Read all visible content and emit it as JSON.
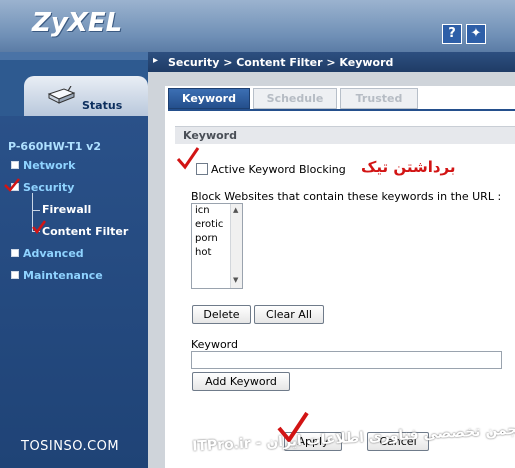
{
  "header": {
    "logo": "ZyXEL",
    "help_icon": "question-mark-icon",
    "wizard_icon": "wizard-icon"
  },
  "sidebar": {
    "status_tab": "Status",
    "status_icon": "router-icon",
    "model": "P-660HW-T1 v2",
    "items": [
      {
        "label": "Network"
      },
      {
        "label": "Security"
      },
      {
        "label": "Firewall"
      },
      {
        "label": "Content Filter"
      },
      {
        "label": "Advanced"
      },
      {
        "label": "Maintenance"
      }
    ]
  },
  "breadcrumb": "Security > Content Filter > Keyword",
  "tabs": [
    {
      "label": "Keyword",
      "active": true
    },
    {
      "label": "Schedule",
      "active": false
    },
    {
      "label": "Trusted",
      "active": false
    }
  ],
  "section": {
    "title": "Keyword",
    "active_checkbox_label": "Active Keyword Blocking",
    "active_checked": false,
    "persian_note": "برداشتن تیک",
    "block_label": "Block Websites that contain these keywords in the URL :",
    "keywords": [
      "icn",
      "erotic",
      "porn",
      "hot"
    ],
    "delete_label": "Delete",
    "clear_all_label": "Clear All",
    "keyword_field_label": "Keyword",
    "keyword_value": "",
    "add_keyword_label": "Add Keyword"
  },
  "footer": {
    "apply_label": "Apply",
    "cancel_label": "Cancel"
  },
  "watermark": {
    "left": "TOSINSO.COM",
    "right": "ITPro.ir - انجمن تخصصی فناوری اطلاعات ایران"
  },
  "colors": {
    "accent": "#244f8c",
    "nav_bg": "#2a5189",
    "annotation_red": "#d21414"
  }
}
